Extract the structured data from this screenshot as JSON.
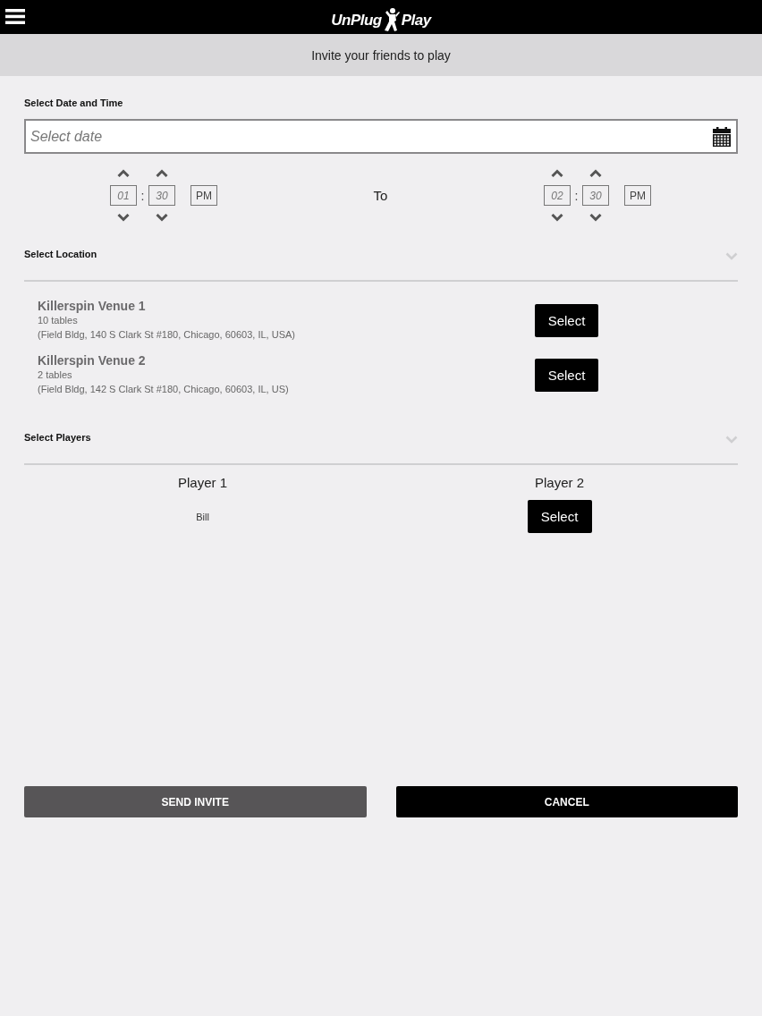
{
  "header": {
    "logo_left": "UnPlug",
    "logo_right": "Play"
  },
  "subheader": {
    "title": "Invite your friends to play"
  },
  "date_time": {
    "label": "Select Date and Time",
    "date_field": {
      "placeholder": "Select date"
    },
    "start": {
      "hour": "01",
      "colon": ":",
      "minute": "30",
      "period": "PM"
    },
    "to_label": "To",
    "end": {
      "hour": "02",
      "colon": ":",
      "minute": "30",
      "period": "PM"
    }
  },
  "location": {
    "label": "Select Location",
    "venues": [
      {
        "name": "Killerspin Venue 1",
        "tables": "10 tables",
        "address": "(Field Bldg, 140 S Clark St #180, Chicago, 60603, IL, USA)",
        "button": "Select"
      },
      {
        "name": "Killerspin Venue 2",
        "tables": "2 tables",
        "address": "(Field Bldg, 142 S Clark St #180, Chicago, 60603, IL, US)",
        "button": "Select"
      }
    ]
  },
  "players": {
    "label": "Select Players",
    "slots": [
      {
        "title": "Player 1",
        "kind": "name",
        "value": "Bill"
      },
      {
        "title": "Player 2",
        "kind": "button",
        "value": "Select"
      }
    ]
  },
  "actions": [
    {
      "label": "SEND INVITE",
      "kind": "secondary"
    },
    {
      "label": "CANCEL",
      "kind": "primary"
    }
  ]
}
